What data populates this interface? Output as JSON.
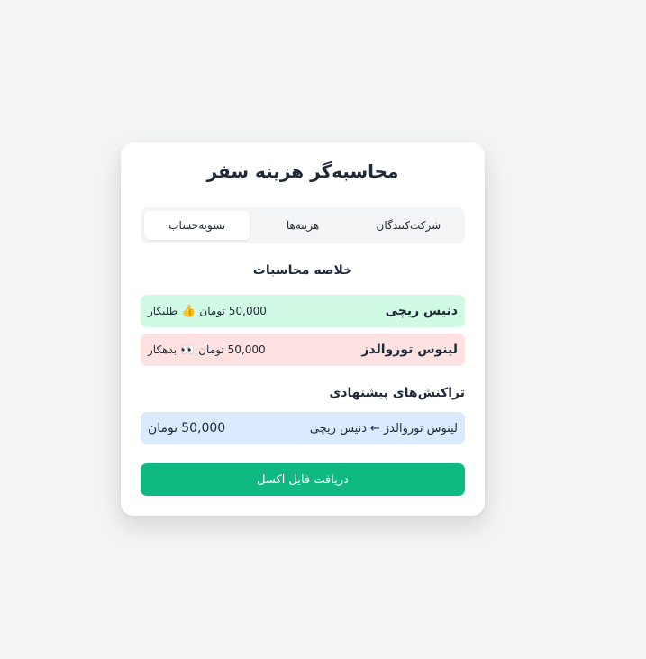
{
  "app": {
    "title": "محاسبه‌گر هزینه سفر"
  },
  "tabs": [
    {
      "label": "شرکت‌کنندگان"
    },
    {
      "label": "هزینه‌ها"
    },
    {
      "label": "تسویه‌حساب",
      "active": true
    }
  ],
  "summary": {
    "title": "خلاصه محاسبات",
    "balances": [
      {
        "name": "دنیس ریچی",
        "amount": "50,000",
        "currency": "تومان",
        "emoji": "👍",
        "status": "طلبکار",
        "color": "#d1fae5"
      },
      {
        "name": "لینوس توروالدز",
        "amount": "50,000",
        "currency": "تومان",
        "emoji": "👀",
        "status": "بدهکار",
        "color": "#fee2e2"
      }
    ]
  },
  "transactions": {
    "title": "تراکنش‌های پیشنهادی",
    "items": [
      {
        "from": "لینوس توروالدز",
        "arrow": "←",
        "to": "دنیس ریچی",
        "amount": "50,000",
        "currency": "تومان",
        "color": "#dbeafe"
      }
    ]
  },
  "actions": {
    "download_label": "دریافت فایل اکسل",
    "color": "#10b981"
  }
}
